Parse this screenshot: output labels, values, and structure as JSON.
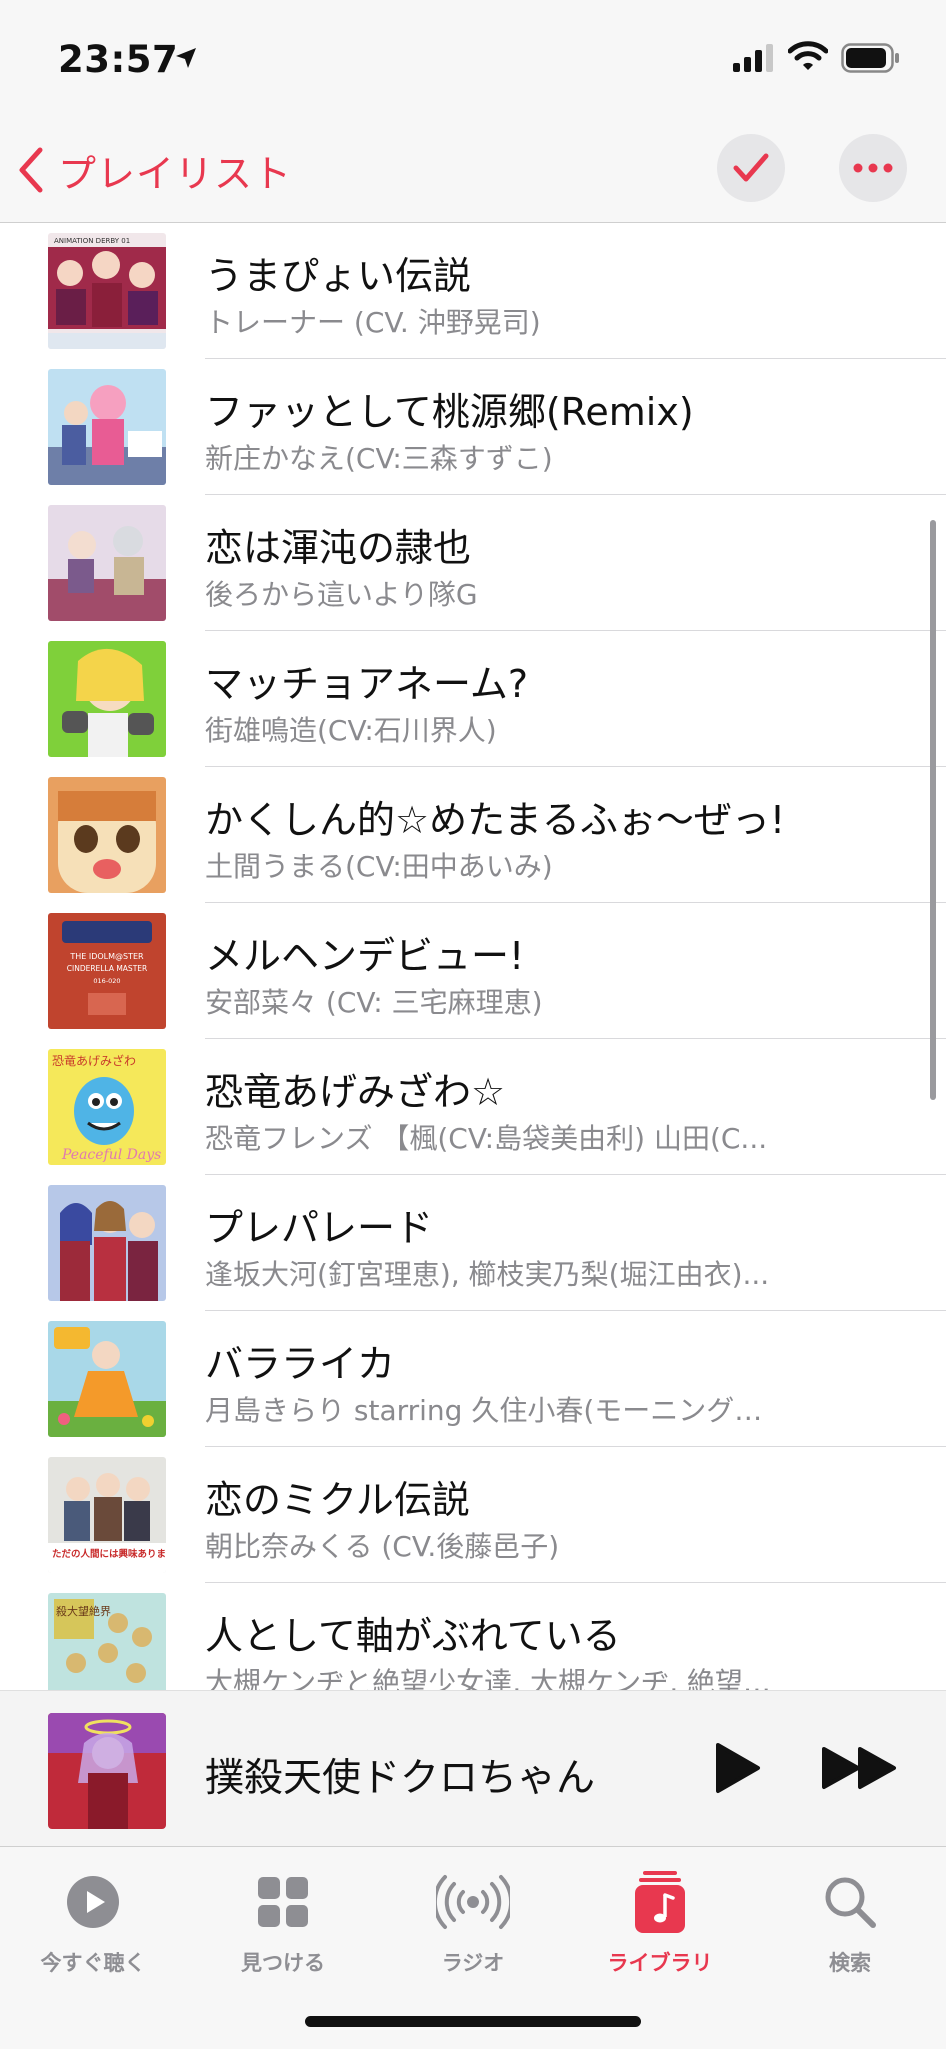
{
  "status_bar": {
    "time": "23:57"
  },
  "nav": {
    "back_label": "プレイリスト"
  },
  "tracks": [
    {
      "title": "うまぴょい伝説",
      "artist": "トレーナー (CV. 沖野晃司)"
    },
    {
      "title": "ファッとして桃源郷(Remix)",
      "artist": "新庄かなえ(CV:三森すずこ)"
    },
    {
      "title": "恋は渾沌の隷也",
      "artist": "後ろから這いより隊G"
    },
    {
      "title": "マッチョアネーム?",
      "artist": "街雄鳴造(CV:石川界人)"
    },
    {
      "title": "かくしん的☆めたまるふぉ〜ぜっ!",
      "artist": "土間うまる(CV:田中あいみ)"
    },
    {
      "title": "メルヘンデビュー!",
      "artist": "安部菜々 (CV: 三宅麻理恵)"
    },
    {
      "title": "恐竜あげみざわ☆",
      "artist": "恐竜フレンズ 【楓(CV:島袋美由利) 山田(C..."
    },
    {
      "title": "プレパレード",
      "artist": "逢坂大河(釘宮理恵), 櫛枝実乃梨(堀江由衣)..."
    },
    {
      "title": "バラライカ",
      "artist": "月島きらり starring 久住小春(モーニング…"
    },
    {
      "title": "恋のミクル伝説",
      "artist": "朝比奈みくる (CV.後藤邑子)"
    },
    {
      "title": "人として軸がぶれている",
      "artist": "大槻ケンヂと絶望少女達, 大槻ケンヂ, 絶望…"
    }
  ],
  "artwork_text": {
    "row1": "ANIMATION DERBY 01",
    "row6_line1": "THE IDOLM@STER",
    "row6_line2": "CINDERELLA MASTER",
    "row6_code": "016-020",
    "row7": "恐竜あげみざわ",
    "row7_script": "Peaceful Days",
    "row10": "ただの人間には興味ありません!!",
    "row11": "殺大望絶界"
  },
  "now_playing": {
    "title": "撲殺天使ドクロちゃん"
  },
  "tabs": [
    {
      "label": "今すぐ聴く",
      "icon": "play-circle-icon"
    },
    {
      "label": "見つける",
      "icon": "grid-icon"
    },
    {
      "label": "ラジオ",
      "icon": "radio-icon"
    },
    {
      "label": "ライブラリ",
      "icon": "music-library-icon",
      "active": true
    },
    {
      "label": "検索",
      "icon": "search-icon"
    }
  ],
  "colors": {
    "accent": "#e8384f",
    "secondary_text": "#8a8a8e"
  }
}
